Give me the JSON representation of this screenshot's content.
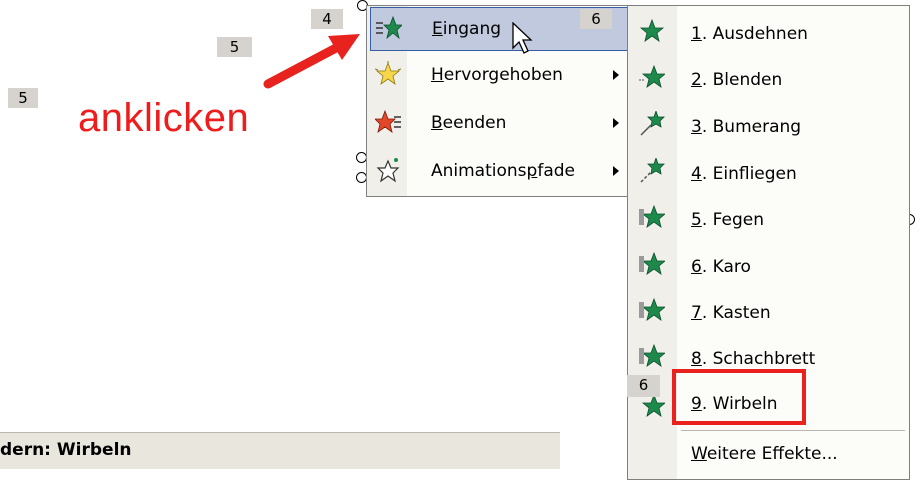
{
  "badges": {
    "b4": "4",
    "b5a": "5",
    "b5b": "5",
    "b6a": "6",
    "b6b": "6"
  },
  "annotation": "anklicken",
  "menu1": {
    "items": [
      {
        "mnemonic": "E",
        "rest": "ingang",
        "icon": "entrance-star-icon",
        "has_submenu": true,
        "highlighted": true
      },
      {
        "mnemonic": "H",
        "rest": "ervorgehoben",
        "icon": "emphasis-star-icon",
        "has_submenu": true
      },
      {
        "mnemonic": "B",
        "rest": "eenden",
        "icon": "exit-star-icon",
        "has_submenu": true
      },
      {
        "pre": "Animations",
        "mnemonic": "p",
        "rest": "fade",
        "icon": "motion-path-star-icon",
        "has_submenu": true
      }
    ]
  },
  "menu2": {
    "items": [
      {
        "mnemonic": "1",
        "rest": ". Ausdehnen"
      },
      {
        "mnemonic": "2",
        "rest": ". Blenden"
      },
      {
        "mnemonic": "3",
        "rest": ". Bumerang"
      },
      {
        "mnemonic": "4",
        "rest": ". Einfliegen"
      },
      {
        "mnemonic": "5",
        "rest": ". Fegen"
      },
      {
        "mnemonic": "6",
        "rest": ". Karo"
      },
      {
        "mnemonic": "7",
        "rest": ". Kasten"
      },
      {
        "mnemonic": "8",
        "rest": ". Schachbrett"
      },
      {
        "mnemonic": "9",
        "rest": ". Wirbeln"
      }
    ],
    "more": {
      "mnemonic": "W",
      "rest": "eitere Effekte..."
    }
  },
  "bottom_bar": "dern: Wirbeln",
  "colors": {
    "annotation": "#ee1c1c",
    "highlight_bg": "#c0c9dd",
    "highlight_border": "#375ea5",
    "red_box": "#e8231f",
    "star_green": "#1d8a4c"
  }
}
